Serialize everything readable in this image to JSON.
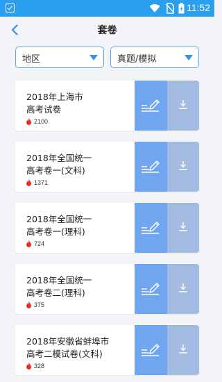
{
  "status_bar": {
    "time": "11:52"
  },
  "header": {
    "title": "套卷"
  },
  "filters": [
    {
      "label": "地区"
    },
    {
      "label": "真题/模拟"
    }
  ],
  "papers": [
    {
      "line1": "2018年上海市",
      "line2": "高考试卷",
      "count": "2100"
    },
    {
      "line1": "2018年全国统一",
      "line2": "高考卷一(文科)",
      "count": "1371"
    },
    {
      "line1": "2018年全国统一",
      "line2": "高考卷一(理科)",
      "count": "724"
    },
    {
      "line1": "2018年全国统一",
      "line2": "高考卷二(理科)",
      "count": "375"
    },
    {
      "line1": "2018年安徽省蚌埠市",
      "line2": "高考二模试卷(文科)",
      "count": "328"
    }
  ],
  "colors": {
    "status_bar": "#2a9ff0",
    "accent": "#3b8fe6",
    "edit_button": "#6fa6ef",
    "download_button": "#a3bbe0",
    "hot_icon": "#e0332b"
  },
  "icons": {
    "back": "chevron-left-icon",
    "filter_caret": "caret-down-icon",
    "hot": "flame-icon",
    "edit": "pencil-icon",
    "download": "download-icon"
  }
}
